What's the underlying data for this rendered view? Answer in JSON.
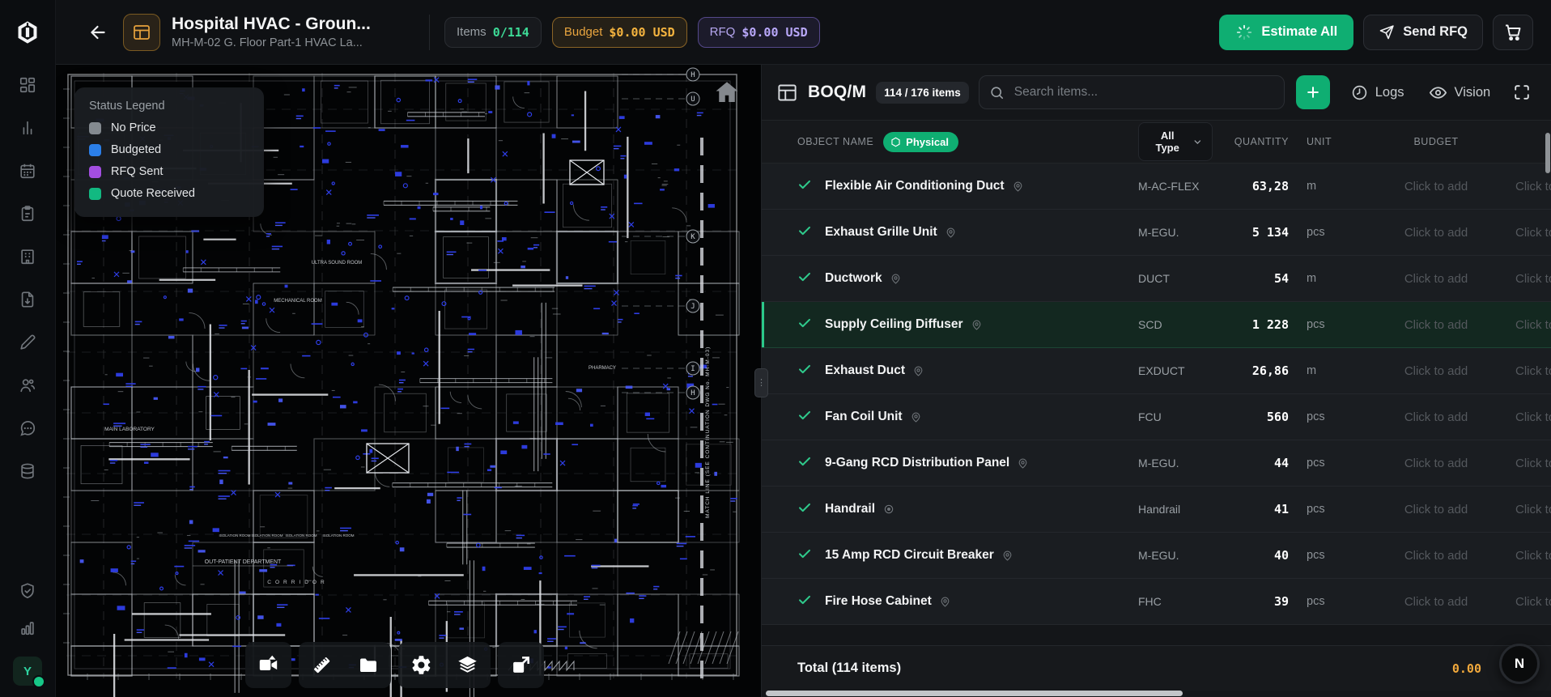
{
  "header": {
    "title": "Hospital HVAC - Groun...",
    "subtitle": "MH-M-02 G. Floor Part-1 HVAC La...",
    "items_label": "Items",
    "items_value": "0/114",
    "budget_label": "Budget",
    "budget_value": "$0.00 USD",
    "rfq_label": "RFQ",
    "rfq_value": "$0.00 USD",
    "estimate_all": "Estimate All",
    "send_rfq": "Send RFQ"
  },
  "sidebar": {
    "avatar_letter": "Y"
  },
  "viewer": {
    "legend": {
      "title": "Status Legend",
      "items": [
        {
          "label": "No Price",
          "color": "#848a90"
        },
        {
          "label": "Budgeted",
          "color": "#2b7fe8"
        },
        {
          "label": "RFQ Sent",
          "color": "#a34ee0"
        },
        {
          "label": "Quote Received",
          "color": "#12b981"
        }
      ]
    },
    "plan_labels": [
      "MAIN LABORATORY",
      "MECHANICAL ROOM",
      "ULTRA SOUND ROOM",
      "PHARMACY",
      "OUT-PATIENT DEPARTMENT",
      "CORRIDOR",
      "ISOLATION ROOM"
    ],
    "grid_bubbles": [
      "H",
      "U",
      "K",
      "J",
      "I",
      "H"
    ],
    "match_line": "MATCH LINE (SEE CONTINUATION DWG No. MH-M-03)"
  },
  "panel": {
    "title": "BOQ/M",
    "count_badge": "114 / 176 items",
    "search_placeholder": "Search items...",
    "logs_label": "Logs",
    "vision_label": "Vision",
    "columns": {
      "object_name": "OBJECT NAME",
      "physical_badge": "Physical",
      "type_filter": "All Type",
      "quantity": "QUANTITY",
      "unit": "UNIT",
      "budget": "BUDGET"
    },
    "click_to_add": "Click to add",
    "rows": [
      {
        "name": "Flexible Air Conditioning Duct",
        "code": "M-AC-FLEX",
        "qty": "63,28",
        "unit": "m",
        "selected": false,
        "icon": "pin"
      },
      {
        "name": "Exhaust Grille Unit",
        "code": "M-EGU.",
        "qty": "5 134",
        "unit": "pcs",
        "selected": false,
        "icon": "pin"
      },
      {
        "name": "Ductwork",
        "code": "DUCT",
        "qty": "54",
        "unit": "m",
        "selected": false,
        "icon": "pin"
      },
      {
        "name": "Supply Ceiling Diffuser",
        "code": "SCD",
        "qty": "1 228",
        "unit": "pcs",
        "selected": true,
        "icon": "pin"
      },
      {
        "name": "Exhaust Duct",
        "code": "EXDUCT",
        "qty": "26,86",
        "unit": "m",
        "selected": false,
        "icon": "pin"
      },
      {
        "name": "Fan Coil Unit",
        "code": "FCU",
        "qty": "560",
        "unit": "pcs",
        "selected": false,
        "icon": "pin"
      },
      {
        "name": "9-Gang RCD Distribution Panel",
        "code": "M-EGU.",
        "qty": "44",
        "unit": "pcs",
        "selected": false,
        "icon": "pin"
      },
      {
        "name": "Handrail",
        "code": "Handrail",
        "qty": "41",
        "unit": "pcs",
        "selected": false,
        "icon": "target"
      },
      {
        "name": "15 Amp RCD Circuit Breaker",
        "code": "M-EGU.",
        "qty": "40",
        "unit": "pcs",
        "selected": false,
        "icon": "pin"
      },
      {
        "name": "Fire Hose Cabinet",
        "code": "FHC",
        "qty": "39",
        "unit": "pcs",
        "selected": false,
        "icon": "pin"
      }
    ],
    "total_label": "Total (114 items)",
    "total_value": "0.00",
    "avatar_letter": "N"
  }
}
